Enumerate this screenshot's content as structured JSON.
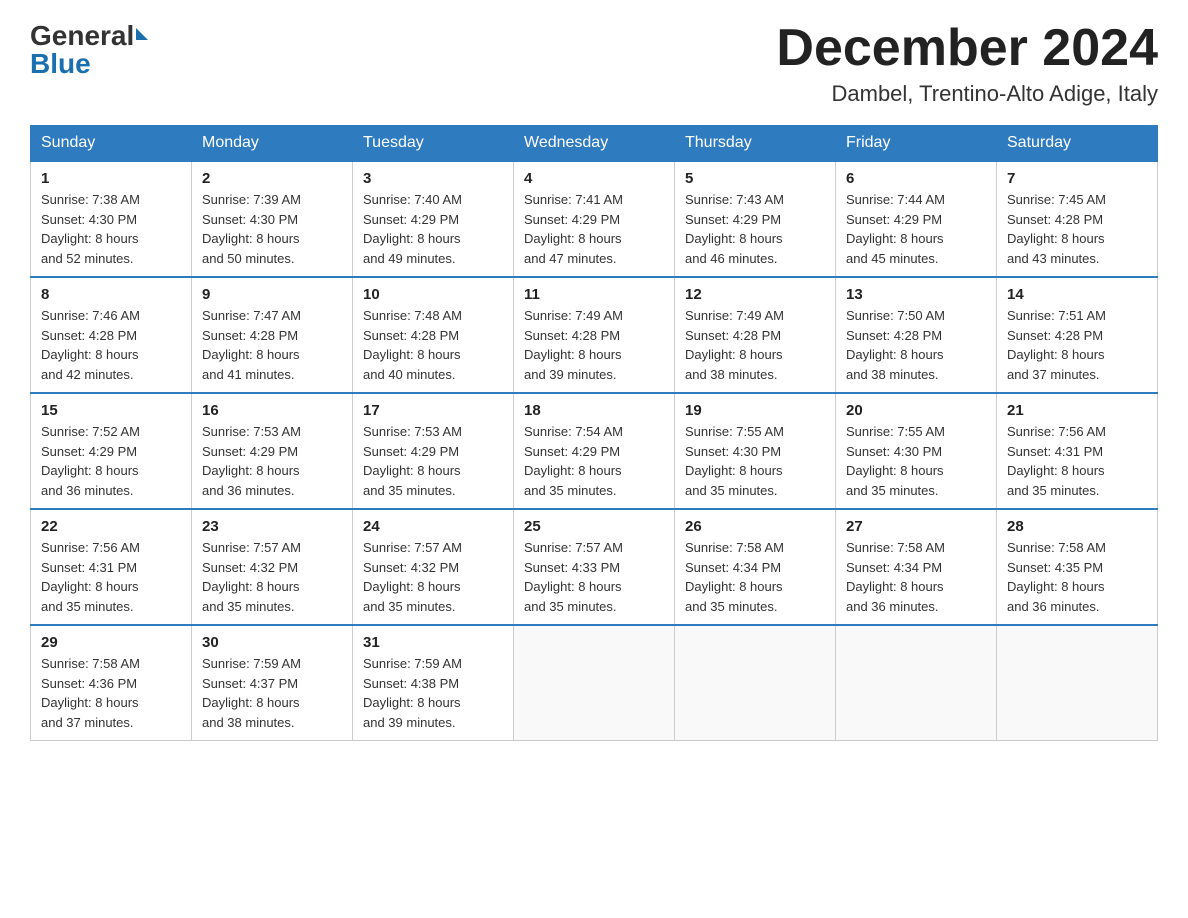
{
  "header": {
    "logo_general": "General",
    "logo_blue": "Blue",
    "title": "December 2024",
    "location": "Dambel, Trentino-Alto Adige, Italy"
  },
  "days_of_week": [
    "Sunday",
    "Monday",
    "Tuesday",
    "Wednesday",
    "Thursday",
    "Friday",
    "Saturday"
  ],
  "weeks": [
    [
      {
        "day": "1",
        "sunrise": "7:38 AM",
        "sunset": "4:30 PM",
        "daylight": "8 hours and 52 minutes."
      },
      {
        "day": "2",
        "sunrise": "7:39 AM",
        "sunset": "4:30 PM",
        "daylight": "8 hours and 50 minutes."
      },
      {
        "day": "3",
        "sunrise": "7:40 AM",
        "sunset": "4:29 PM",
        "daylight": "8 hours and 49 minutes."
      },
      {
        "day": "4",
        "sunrise": "7:41 AM",
        "sunset": "4:29 PM",
        "daylight": "8 hours and 47 minutes."
      },
      {
        "day": "5",
        "sunrise": "7:43 AM",
        "sunset": "4:29 PM",
        "daylight": "8 hours and 46 minutes."
      },
      {
        "day": "6",
        "sunrise": "7:44 AM",
        "sunset": "4:29 PM",
        "daylight": "8 hours and 45 minutes."
      },
      {
        "day": "7",
        "sunrise": "7:45 AM",
        "sunset": "4:28 PM",
        "daylight": "8 hours and 43 minutes."
      }
    ],
    [
      {
        "day": "8",
        "sunrise": "7:46 AM",
        "sunset": "4:28 PM",
        "daylight": "8 hours and 42 minutes."
      },
      {
        "day": "9",
        "sunrise": "7:47 AM",
        "sunset": "4:28 PM",
        "daylight": "8 hours and 41 minutes."
      },
      {
        "day": "10",
        "sunrise": "7:48 AM",
        "sunset": "4:28 PM",
        "daylight": "8 hours and 40 minutes."
      },
      {
        "day": "11",
        "sunrise": "7:49 AM",
        "sunset": "4:28 PM",
        "daylight": "8 hours and 39 minutes."
      },
      {
        "day": "12",
        "sunrise": "7:49 AM",
        "sunset": "4:28 PM",
        "daylight": "8 hours and 38 minutes."
      },
      {
        "day": "13",
        "sunrise": "7:50 AM",
        "sunset": "4:28 PM",
        "daylight": "8 hours and 38 minutes."
      },
      {
        "day": "14",
        "sunrise": "7:51 AM",
        "sunset": "4:28 PM",
        "daylight": "8 hours and 37 minutes."
      }
    ],
    [
      {
        "day": "15",
        "sunrise": "7:52 AM",
        "sunset": "4:29 PM",
        "daylight": "8 hours and 36 minutes."
      },
      {
        "day": "16",
        "sunrise": "7:53 AM",
        "sunset": "4:29 PM",
        "daylight": "8 hours and 36 minutes."
      },
      {
        "day": "17",
        "sunrise": "7:53 AM",
        "sunset": "4:29 PM",
        "daylight": "8 hours and 35 minutes."
      },
      {
        "day": "18",
        "sunrise": "7:54 AM",
        "sunset": "4:29 PM",
        "daylight": "8 hours and 35 minutes."
      },
      {
        "day": "19",
        "sunrise": "7:55 AM",
        "sunset": "4:30 PM",
        "daylight": "8 hours and 35 minutes."
      },
      {
        "day": "20",
        "sunrise": "7:55 AM",
        "sunset": "4:30 PM",
        "daylight": "8 hours and 35 minutes."
      },
      {
        "day": "21",
        "sunrise": "7:56 AM",
        "sunset": "4:31 PM",
        "daylight": "8 hours and 35 minutes."
      }
    ],
    [
      {
        "day": "22",
        "sunrise": "7:56 AM",
        "sunset": "4:31 PM",
        "daylight": "8 hours and 35 minutes."
      },
      {
        "day": "23",
        "sunrise": "7:57 AM",
        "sunset": "4:32 PM",
        "daylight": "8 hours and 35 minutes."
      },
      {
        "day": "24",
        "sunrise": "7:57 AM",
        "sunset": "4:32 PM",
        "daylight": "8 hours and 35 minutes."
      },
      {
        "day": "25",
        "sunrise": "7:57 AM",
        "sunset": "4:33 PM",
        "daylight": "8 hours and 35 minutes."
      },
      {
        "day": "26",
        "sunrise": "7:58 AM",
        "sunset": "4:34 PM",
        "daylight": "8 hours and 35 minutes."
      },
      {
        "day": "27",
        "sunrise": "7:58 AM",
        "sunset": "4:34 PM",
        "daylight": "8 hours and 36 minutes."
      },
      {
        "day": "28",
        "sunrise": "7:58 AM",
        "sunset": "4:35 PM",
        "daylight": "8 hours and 36 minutes."
      }
    ],
    [
      {
        "day": "29",
        "sunrise": "7:58 AM",
        "sunset": "4:36 PM",
        "daylight": "8 hours and 37 minutes."
      },
      {
        "day": "30",
        "sunrise": "7:59 AM",
        "sunset": "4:37 PM",
        "daylight": "8 hours and 38 minutes."
      },
      {
        "day": "31",
        "sunrise": "7:59 AM",
        "sunset": "4:38 PM",
        "daylight": "8 hours and 39 minutes."
      },
      null,
      null,
      null,
      null
    ]
  ],
  "labels": {
    "sunrise": "Sunrise:",
    "sunset": "Sunset:",
    "daylight": "Daylight:"
  }
}
